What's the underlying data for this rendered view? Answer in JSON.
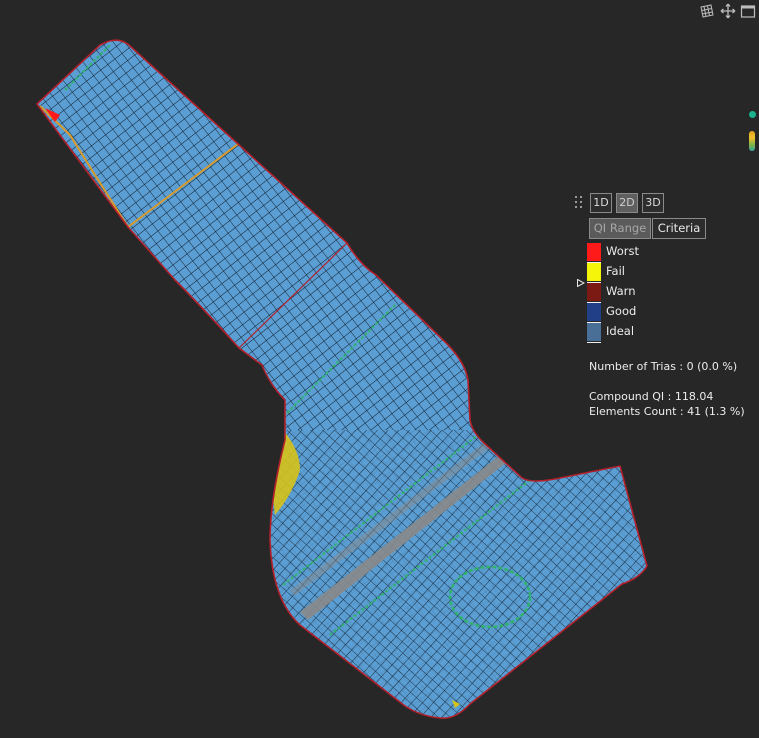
{
  "toolbar": {
    "icons": [
      "mesh-view-icon",
      "move-icon",
      "window-icon"
    ]
  },
  "side_indicators": {
    "dot_color": "#19b38d"
  },
  "panel": {
    "dimensions": [
      {
        "label": "1D",
        "active": false
      },
      {
        "label": "2D",
        "active": true
      },
      {
        "label": "3D",
        "active": false
      }
    ],
    "modes": [
      {
        "label": "QI Range",
        "active": true
      },
      {
        "label": "Criteria",
        "active": false
      }
    ],
    "legend": [
      {
        "label": "Worst",
        "color": "#ff1a1a"
      },
      {
        "label": "Fail",
        "color": "#f5f50a"
      },
      {
        "label": "Warn",
        "color": "#7a1a12"
      },
      {
        "label": "Good",
        "color": "#213f86"
      },
      {
        "label": "Ideal",
        "color": "#4a6f96"
      }
    ],
    "trias": "Number of Trias : 0 (0.0 %)",
    "compound_qi": "Compound QI : 118.04",
    "elements_count": "Elements Count : 41 (1.3 %)"
  },
  "mesh": {
    "fill_color": "#5b9ed3",
    "edge_color": "#b3202a",
    "feature_line_color": "#d99a2a",
    "highlight_color": "#2fb36b",
    "fail_color": "#d7c21a"
  }
}
